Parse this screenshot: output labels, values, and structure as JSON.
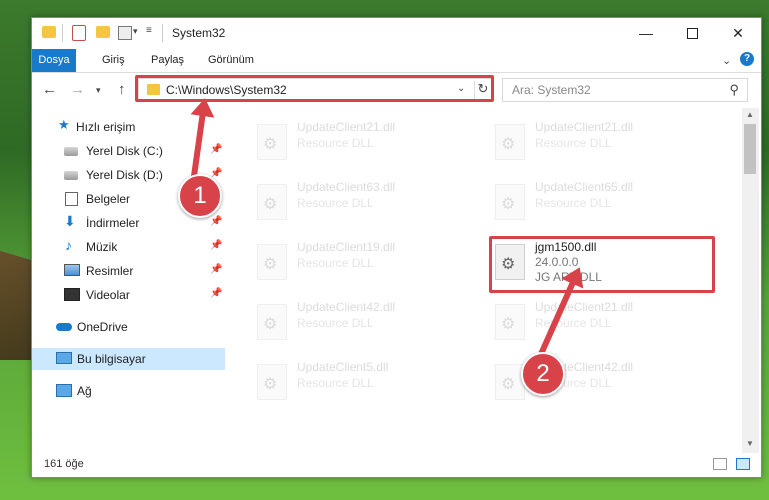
{
  "window": {
    "title": "System32",
    "minimize_glyph": "—",
    "close_glyph": "✕"
  },
  "ribbon": {
    "tabs": [
      "Dosya",
      "Giriş",
      "Paylaş",
      "Görünüm"
    ],
    "help_glyph": "?"
  },
  "navigation": {
    "address": "C:\\Windows\\System32",
    "search_placeholder": "Ara: System32"
  },
  "sidebar": {
    "items": [
      {
        "label": "Hızlı erişim",
        "icon": "star-icon"
      },
      {
        "label": "Yerel Disk (C:)",
        "icon": "drive-icon",
        "pinned": true
      },
      {
        "label": "Yerel Disk (D:)",
        "icon": "drive-icon",
        "pinned": true
      },
      {
        "label": "Belgeler",
        "icon": "documents-icon",
        "pinned": true
      },
      {
        "label": "İndirmeler",
        "icon": "download-icon",
        "pinned": true
      },
      {
        "label": "Müzik",
        "icon": "music-icon",
        "pinned": true
      },
      {
        "label": "Resimler",
        "icon": "pictures-icon",
        "pinned": true
      },
      {
        "label": "Videolar",
        "icon": "videos-icon",
        "pinned": true
      },
      {
        "label": "OneDrive",
        "icon": "onedrive-icon"
      },
      {
        "label": "Bu bilgisayar",
        "icon": "computer-icon",
        "selected": true
      },
      {
        "label": "Ağ",
        "icon": "network-icon"
      }
    ]
  },
  "files": [
    {
      "name": "UpdateClient21.dll",
      "desc": "Resource DLL"
    },
    {
      "name": "UpdateClient21.dll",
      "desc": "Resource DLL"
    },
    {
      "name": "UpdateClient63.dll",
      "desc": "Resource DLL"
    },
    {
      "name": "UpdateClient65.dll",
      "desc": "Resource DLL"
    },
    {
      "name": "UpdateClient19.dll",
      "desc": "Resource DLL"
    },
    {
      "name": "jgm1500.dll",
      "version": "24.0.0.0",
      "desc": "JG ART DLL",
      "active": true
    },
    {
      "name": "UpdateClient42.dll",
      "desc": "Resource DLL"
    },
    {
      "name": "UpdateClient21.dll",
      "desc": "Resource DLL"
    },
    {
      "name": "UpdateClient5.dll",
      "desc": "Resource DLL"
    },
    {
      "name": "UpdateClient42.dll",
      "desc": "Resource DLL"
    }
  ],
  "status": {
    "item_count": "161 öğe"
  },
  "annotations": {
    "step1": "1",
    "step2": "2",
    "color": "#d8434a"
  }
}
